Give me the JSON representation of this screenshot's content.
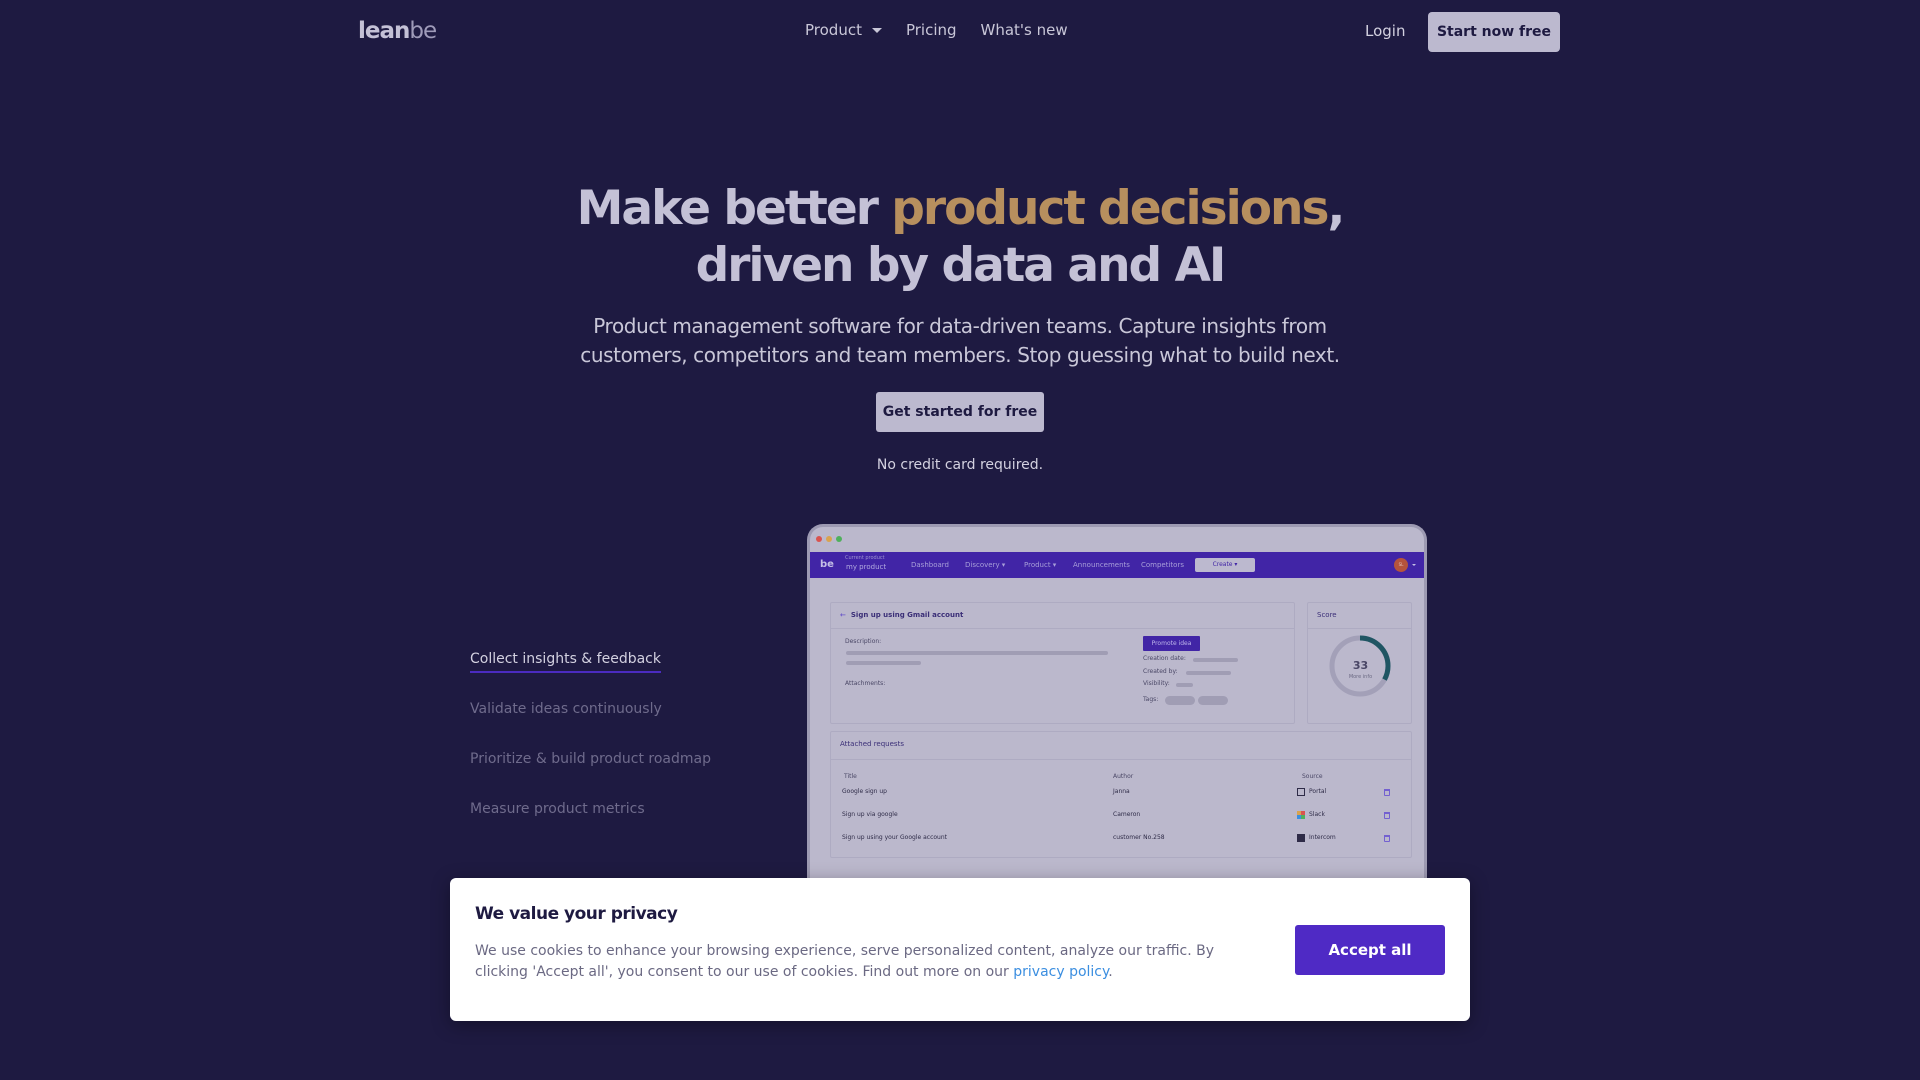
{
  "nav": {
    "logo_main": "lean",
    "logo_accent": "be",
    "links": [
      {
        "label": "Product",
        "has_dropdown": true
      },
      {
        "label": "Pricing",
        "has_dropdown": false
      },
      {
        "label": "What's new",
        "has_dropdown": false
      }
    ],
    "login": "Login",
    "start_button": "Start now free"
  },
  "hero": {
    "title_part1": "Make better ",
    "title_accent": "product decisions",
    "title_part2": ",",
    "title_line2": "driven by data and AI",
    "subtitle_line1": "Product management software for data-driven teams. Capture insights from",
    "subtitle_line2": "customers, competitors and team members. Stop guessing what to build next.",
    "cta": "Get started for free",
    "note": "No credit card required."
  },
  "features": [
    {
      "label": "Collect insights & feedback",
      "active": true
    },
    {
      "label": "Validate ideas continuously",
      "active": false
    },
    {
      "label": "Prioritize & build product roadmap",
      "active": false
    },
    {
      "label": "Measure product metrics",
      "active": false
    }
  ],
  "mock": {
    "window_dots": [
      "#d9534f",
      "#d9a34f",
      "#4fb05c"
    ],
    "app_logo": "be",
    "current_product_label": "Current product",
    "current_product_value": "my product",
    "menu": [
      "Dashboard",
      "Discovery ▾",
      "Product ▾",
      "Announcements",
      "Competitors"
    ],
    "create_button": "Create ▾",
    "avatar_initials": "SL",
    "idea": {
      "back_arrow": "←",
      "title": "Sign up using Gmail account",
      "description_label": "Description:",
      "attachments_label": "Attachments:",
      "promote_button": "Promote idea",
      "creation_date_label": "Creation date:",
      "created_by_label": "Created by:",
      "visibility_label": "Visibility:",
      "tags_label": "Tags:"
    },
    "score": {
      "title": "Score",
      "value": "33",
      "percent": 33,
      "link": "More info"
    },
    "requests": {
      "title": "Attached requests",
      "columns": [
        "Title",
        "Author",
        "Source"
      ],
      "rows": [
        {
          "title": "Google sign up",
          "author": "Janna",
          "source": "Portal"
        },
        {
          "title": "Sign up via google",
          "author": "Cameron",
          "source": "Slack"
        },
        {
          "title": "Sign up using your Google account",
          "author": "customer No.258",
          "source": "Intercom"
        }
      ]
    }
  },
  "cookie": {
    "title": "We value your privacy",
    "text_line1": "We use cookies to enhance your browsing experience, serve personalized content, analyze our traffic. By",
    "text_line2": "clicking 'Accept all', you consent to our use of cookies. Find out more on our ",
    "link": "privacy policy",
    "text_end": ".",
    "accept": "Accept all"
  },
  "colors": {
    "background": "#1e1a41",
    "accent_gold": "#b78f5e",
    "primary_purple": "#4f2ac5",
    "link_blue": "#3b8ee0",
    "score_ring": "#1f5563"
  }
}
